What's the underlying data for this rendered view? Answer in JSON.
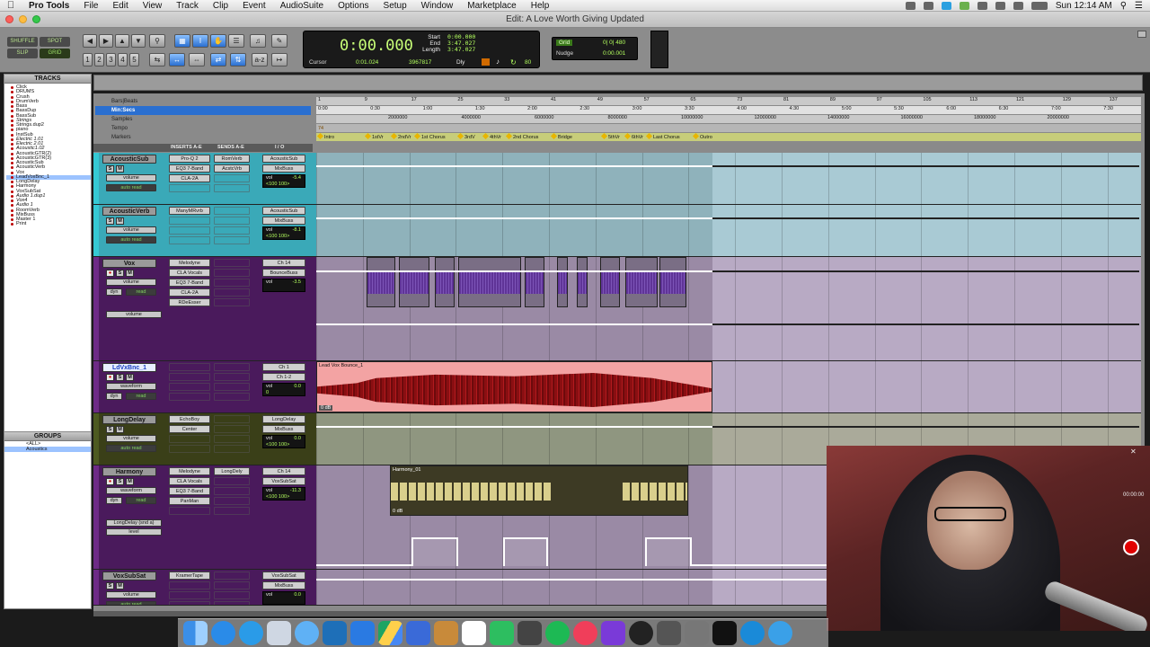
{
  "menubar": {
    "app": "Pro Tools",
    "items": [
      "File",
      "Edit",
      "View",
      "Track",
      "Clip",
      "Event",
      "AudioSuite",
      "Options",
      "Setup",
      "Window",
      "Marketplace",
      "Help"
    ],
    "clock": "Sun 12:14 AM"
  },
  "window": {
    "title": "Edit: A Love Worth Giving Updated"
  },
  "toolbar": {
    "modes": [
      "SHUFFLE",
      "SPOT",
      "SLIP",
      "GRID"
    ],
    "counter": {
      "main": "0:00.000",
      "labels": [
        "Start",
        "End",
        "Length"
      ],
      "values": [
        "0:00.000",
        "3:47.027",
        "3:47.027"
      ],
      "cursor_label": "Cursor",
      "cursor_value": "0:01.024",
      "samples": "3967817",
      "dly": "Dly",
      "right_num": "80"
    },
    "grid": {
      "label": "Grid",
      "value": "0| 0| 480",
      "nudge_label": "Nudge",
      "nudge_value": "0:00.001"
    },
    "zoom_presets": [
      "1",
      "2",
      "3",
      "4",
      "5"
    ]
  },
  "panels": {
    "tracks_title": "TRACKS",
    "groups_title": "GROUPS"
  },
  "tracklist": [
    "Click",
    "DRUMS",
    "Crush",
    "DrumVerb",
    "Bass",
    "BassDup",
    "BassSub",
    "Strings",
    "Strings.dup2",
    "piano",
    "InstSub",
    "Electric 1.01",
    "Electric 2.01",
    "Acoustic1.02",
    "AcousticGTR(2)",
    "AcousticGTR(3)",
    "AcousticSub",
    "AcousticVerb",
    "Vox",
    "LeadVoxBnc_1",
    "LongDelay",
    "Harmony",
    "VoxSubSat",
    "Audio 1.dup1",
    "Vox4",
    "Audio 1",
    "RoomVerb",
    "MixBuss",
    "Master 1",
    "Print"
  ],
  "groups": [
    "<ALL>",
    "Acoustics"
  ],
  "rulers": {
    "names": [
      "Bars|Beats",
      "Min:Secs",
      "Samples",
      "Tempo",
      "Markers"
    ],
    "bars": [
      "1",
      "9",
      "17",
      "25",
      "33",
      "41",
      "49",
      "57",
      "65",
      "73",
      "81",
      "89",
      "97",
      "105",
      "113",
      "121",
      "129",
      "137"
    ],
    "minsecs": [
      "0:00",
      "0:30",
      "1:00",
      "1:30",
      "2:00",
      "2:30",
      "3:00",
      "3:30",
      "4:00",
      "4:30",
      "5:00",
      "5:30",
      "6:00",
      "6:30",
      "7:00",
      "7:30"
    ],
    "samples": [
      "2000000",
      "4000000",
      "6000000",
      "8000000",
      "10000000",
      "12000000",
      "14000000",
      "16000000",
      "18000000",
      "20000000"
    ],
    "tempo": "74",
    "markers": [
      "Intro",
      "1stVr",
      "2ndVr",
      "1st Chorus",
      "3rdV",
      "4thVr",
      "2nd Chorus",
      "Bridge",
      "5thVr",
      "6thVr",
      "Last Chorus",
      "Outro"
    ]
  },
  "columns": {
    "inserts": "INSERTS A-E",
    "sends": "SENDS A-E",
    "io": "I / O"
  },
  "tracks": [
    {
      "name": "AcousticSub",
      "color": "#35c9d4",
      "inserts": [
        "Pro-Q 2",
        "EQ3 7-Band",
        "CLA-2A"
      ],
      "sends": [
        "RomVerb",
        "AcstcVrb"
      ],
      "io": [
        "AcousticSub",
        "MixBuss"
      ],
      "vol": "-5.4",
      "pan": "<100   100>",
      "auto": "auto read",
      "view": "volume"
    },
    {
      "name": "AcousticVerb",
      "color": "#35c9d4",
      "inserts": [
        "ManyMRvrb"
      ],
      "sends": [],
      "io": [
        "AcousticSub",
        "MixBuss"
      ],
      "vol": "-8.1",
      "pan": "<100   100>",
      "auto": "auto read",
      "view": "volume"
    },
    {
      "name": "Vox",
      "color": "#6d2a86",
      "inserts": [
        "Melodyne",
        "CLA Vocals",
        "EQ3 7-Band",
        "CLA-2A",
        "RDeEsser"
      ],
      "sends": [],
      "io": [
        "Ch 14",
        "BounceBuss"
      ],
      "vol": "-3.5",
      "auto": "read",
      "view": "volume",
      "dyn": "dyn",
      "sublane": "volume"
    },
    {
      "name": "LdVxBnc_1",
      "color": "#6d2a86",
      "inserts": [],
      "sends": [],
      "io": [
        "Ch 1",
        "Ch 1-2"
      ],
      "vol": "0.0",
      "pan": "0",
      "auto": "read",
      "view": "waveform",
      "dyn": "dyn",
      "clip": "Lead Vox Bounce_1",
      "clip_gain": "0 dB"
    },
    {
      "name": "LongDelay",
      "color": "#4d5a21",
      "inserts": [
        "EchoBoy",
        "Center"
      ],
      "sends": [],
      "io": [
        "LongDelay",
        "MixBuss"
      ],
      "vol": "0.0",
      "pan": "<100   100>",
      "auto": "auto read",
      "view": "volume"
    },
    {
      "name": "Harmony",
      "color": "#6d2a86",
      "inserts": [
        "Melodyne",
        "CLA Vocals",
        "EQ3 7-Band",
        "PanMan"
      ],
      "sends": [
        "LongDely"
      ],
      "io": [
        "Ch 14",
        "VoxSubSat"
      ],
      "vol": "-11.3",
      "pan": "<100   100>",
      "auto": "read",
      "view": "waveform",
      "dyn": "dyn",
      "clip": "Harmony_01",
      "clip_gain": "0 dB",
      "sublane": "LongDelay (snd a)",
      "sublane2": "level"
    },
    {
      "name": "VoxSubSat",
      "color": "#6d2a86",
      "inserts": [
        "KramerTape"
      ],
      "sends": [],
      "io": [
        "VoxSubSat",
        "MixBuss"
      ],
      "vol": "0.0",
      "auto": "auto read",
      "view": "volume"
    }
  ],
  "webcam": {
    "timecode": "00:00:00"
  },
  "colors": {
    "accent": "#2a6fd0",
    "counter_green": "#b3ff5e",
    "lead_clip": "#f3a3a3",
    "harmony_clip": "#3d3a24"
  }
}
